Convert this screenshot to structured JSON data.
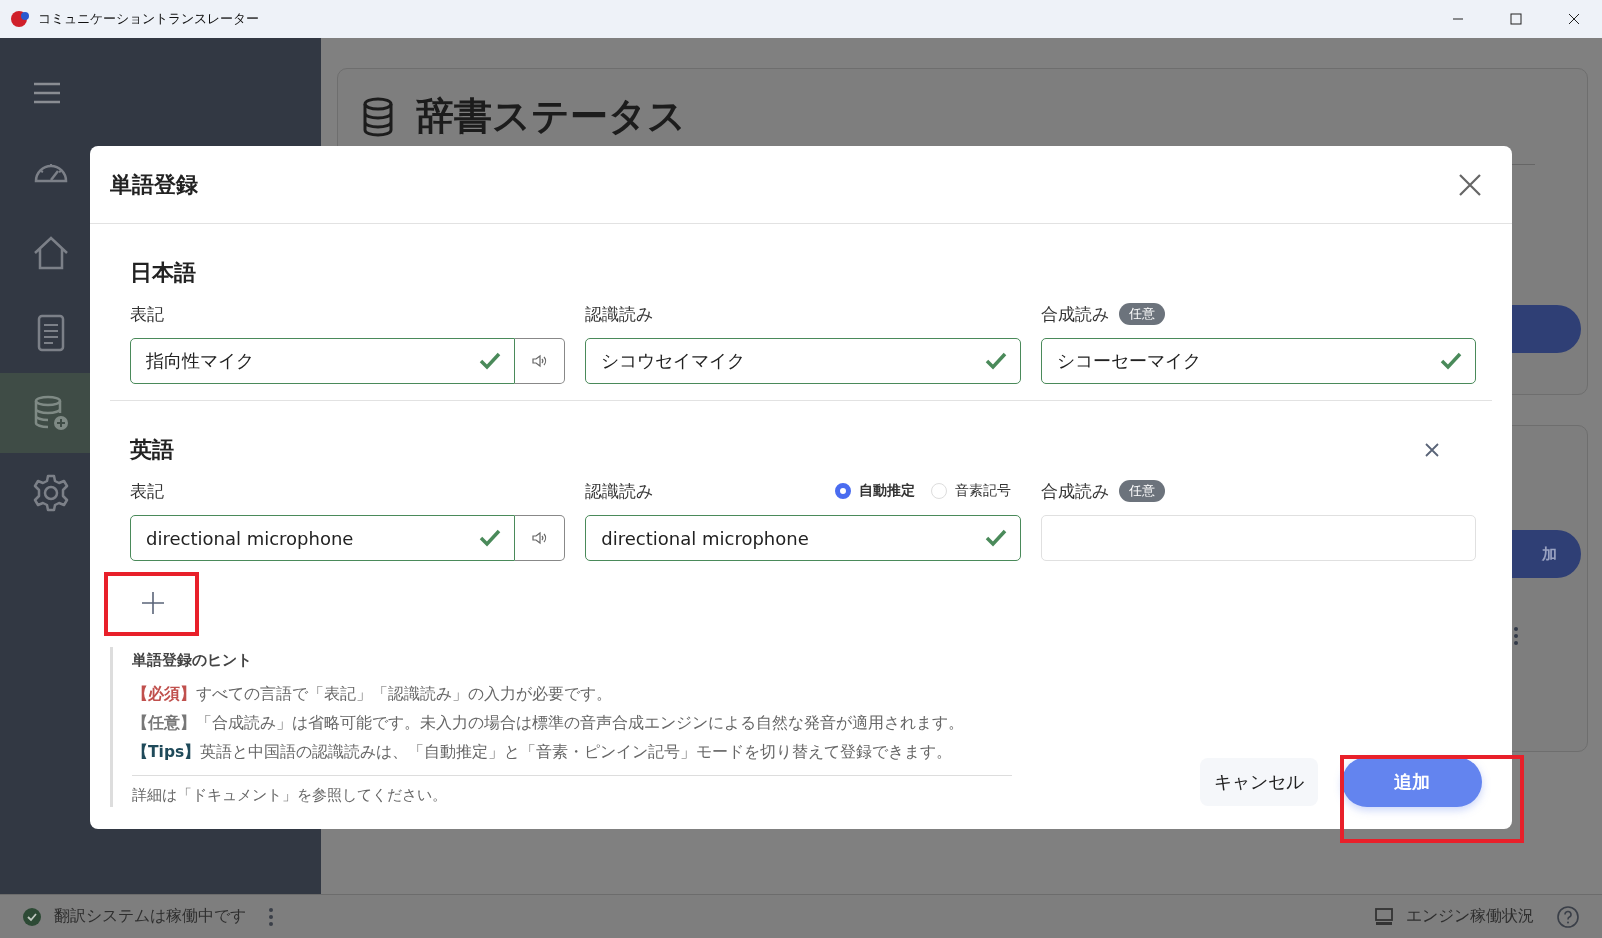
{
  "window": {
    "title": "コミュニケーショントランスレーター"
  },
  "sidebar": {
    "items": [
      {
        "kind": "menu",
        "selected": false
      },
      {
        "kind": "gauge",
        "selected": false
      },
      {
        "kind": "home",
        "selected": false
      },
      {
        "kind": "document",
        "selected": false
      },
      {
        "kind": "database",
        "selected": true
      },
      {
        "kind": "settings",
        "selected": false
      }
    ]
  },
  "page": {
    "title": "辞書ステータス",
    "partial_button": "加"
  },
  "dialog": {
    "title": "単語登録",
    "sections": [
      {
        "heading": "日本語",
        "removable": false,
        "fields": [
          {
            "label": "表記",
            "value": "指向性マイク",
            "valid": true,
            "speaker": true
          },
          {
            "label": "認識読み",
            "value": "シコウセイマイク",
            "valid": true,
            "speaker": false
          },
          {
            "label": "合成読み",
            "badge": "任意",
            "value": "シコーセーマイク",
            "valid": true,
            "speaker": false
          }
        ]
      },
      {
        "heading": "英語",
        "removable": true,
        "fields": [
          {
            "label": "表記",
            "value": "directional microphone",
            "valid": true,
            "speaker": true
          },
          {
            "label": "認識読み",
            "modes": [
              {
                "label": "自動推定",
                "selected": true
              },
              {
                "label": "音素記号",
                "selected": false
              }
            ],
            "value": "directional microphone",
            "valid": true,
            "speaker": false
          },
          {
            "label": "合成読み",
            "badge": "任意",
            "valid": false,
            "speaker": false
          }
        ]
      }
    ],
    "hints": {
      "title": "単語登録のヒント",
      "lines": [
        {
          "kind": "required",
          "tag": "【必須】",
          "text": "すべての言語で「表記」「認識読み」の入力が必要です。"
        },
        {
          "kind": "optional",
          "tag": "【任意】",
          "text": "「合成読み」は省略可能です。未入力の場合は標準の音声合成エンジンによる自然な発音が適用されます。"
        },
        {
          "kind": "tips",
          "tag": "【Tips】",
          "text": "英語と中国語の認識読みは、「自動推定」と「音素・ピンイン記号」モードを切り替えて登録できます。"
        }
      ],
      "note": "詳細は「ドキュメント」を参照してください。"
    },
    "buttons": {
      "cancel": "キャンセル",
      "add": "追加"
    }
  },
  "status_bar": {
    "message": "翻訳システムは稼働中です",
    "engine": "エンジン稼働状況"
  }
}
